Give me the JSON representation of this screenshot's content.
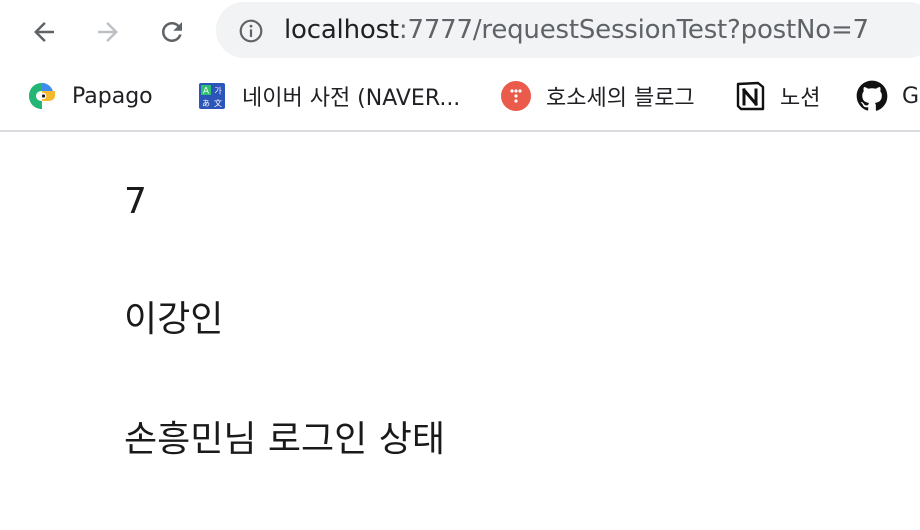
{
  "browser": {
    "url_host": "localhost",
    "url_path": ":7777/requestSessionTest?postNo=7"
  },
  "bookmarks": [
    {
      "label": "Papago",
      "icon": "papago-icon"
    },
    {
      "label": "네이버 사전 (NAVER...",
      "icon": "naver-dictionary-icon"
    },
    {
      "label": "호소세의 블로그",
      "icon": "blog-icon"
    },
    {
      "label": "노션",
      "icon": "notion-icon"
    },
    {
      "label": "G",
      "icon": "github-icon"
    }
  ],
  "page": {
    "post_no": "7",
    "author": "이강인",
    "login_status": "손흥민님 로그인 상태"
  },
  "colors": {
    "omnibox_bg": "#f1f3f4",
    "blog_icon": "#ea5b4c"
  }
}
